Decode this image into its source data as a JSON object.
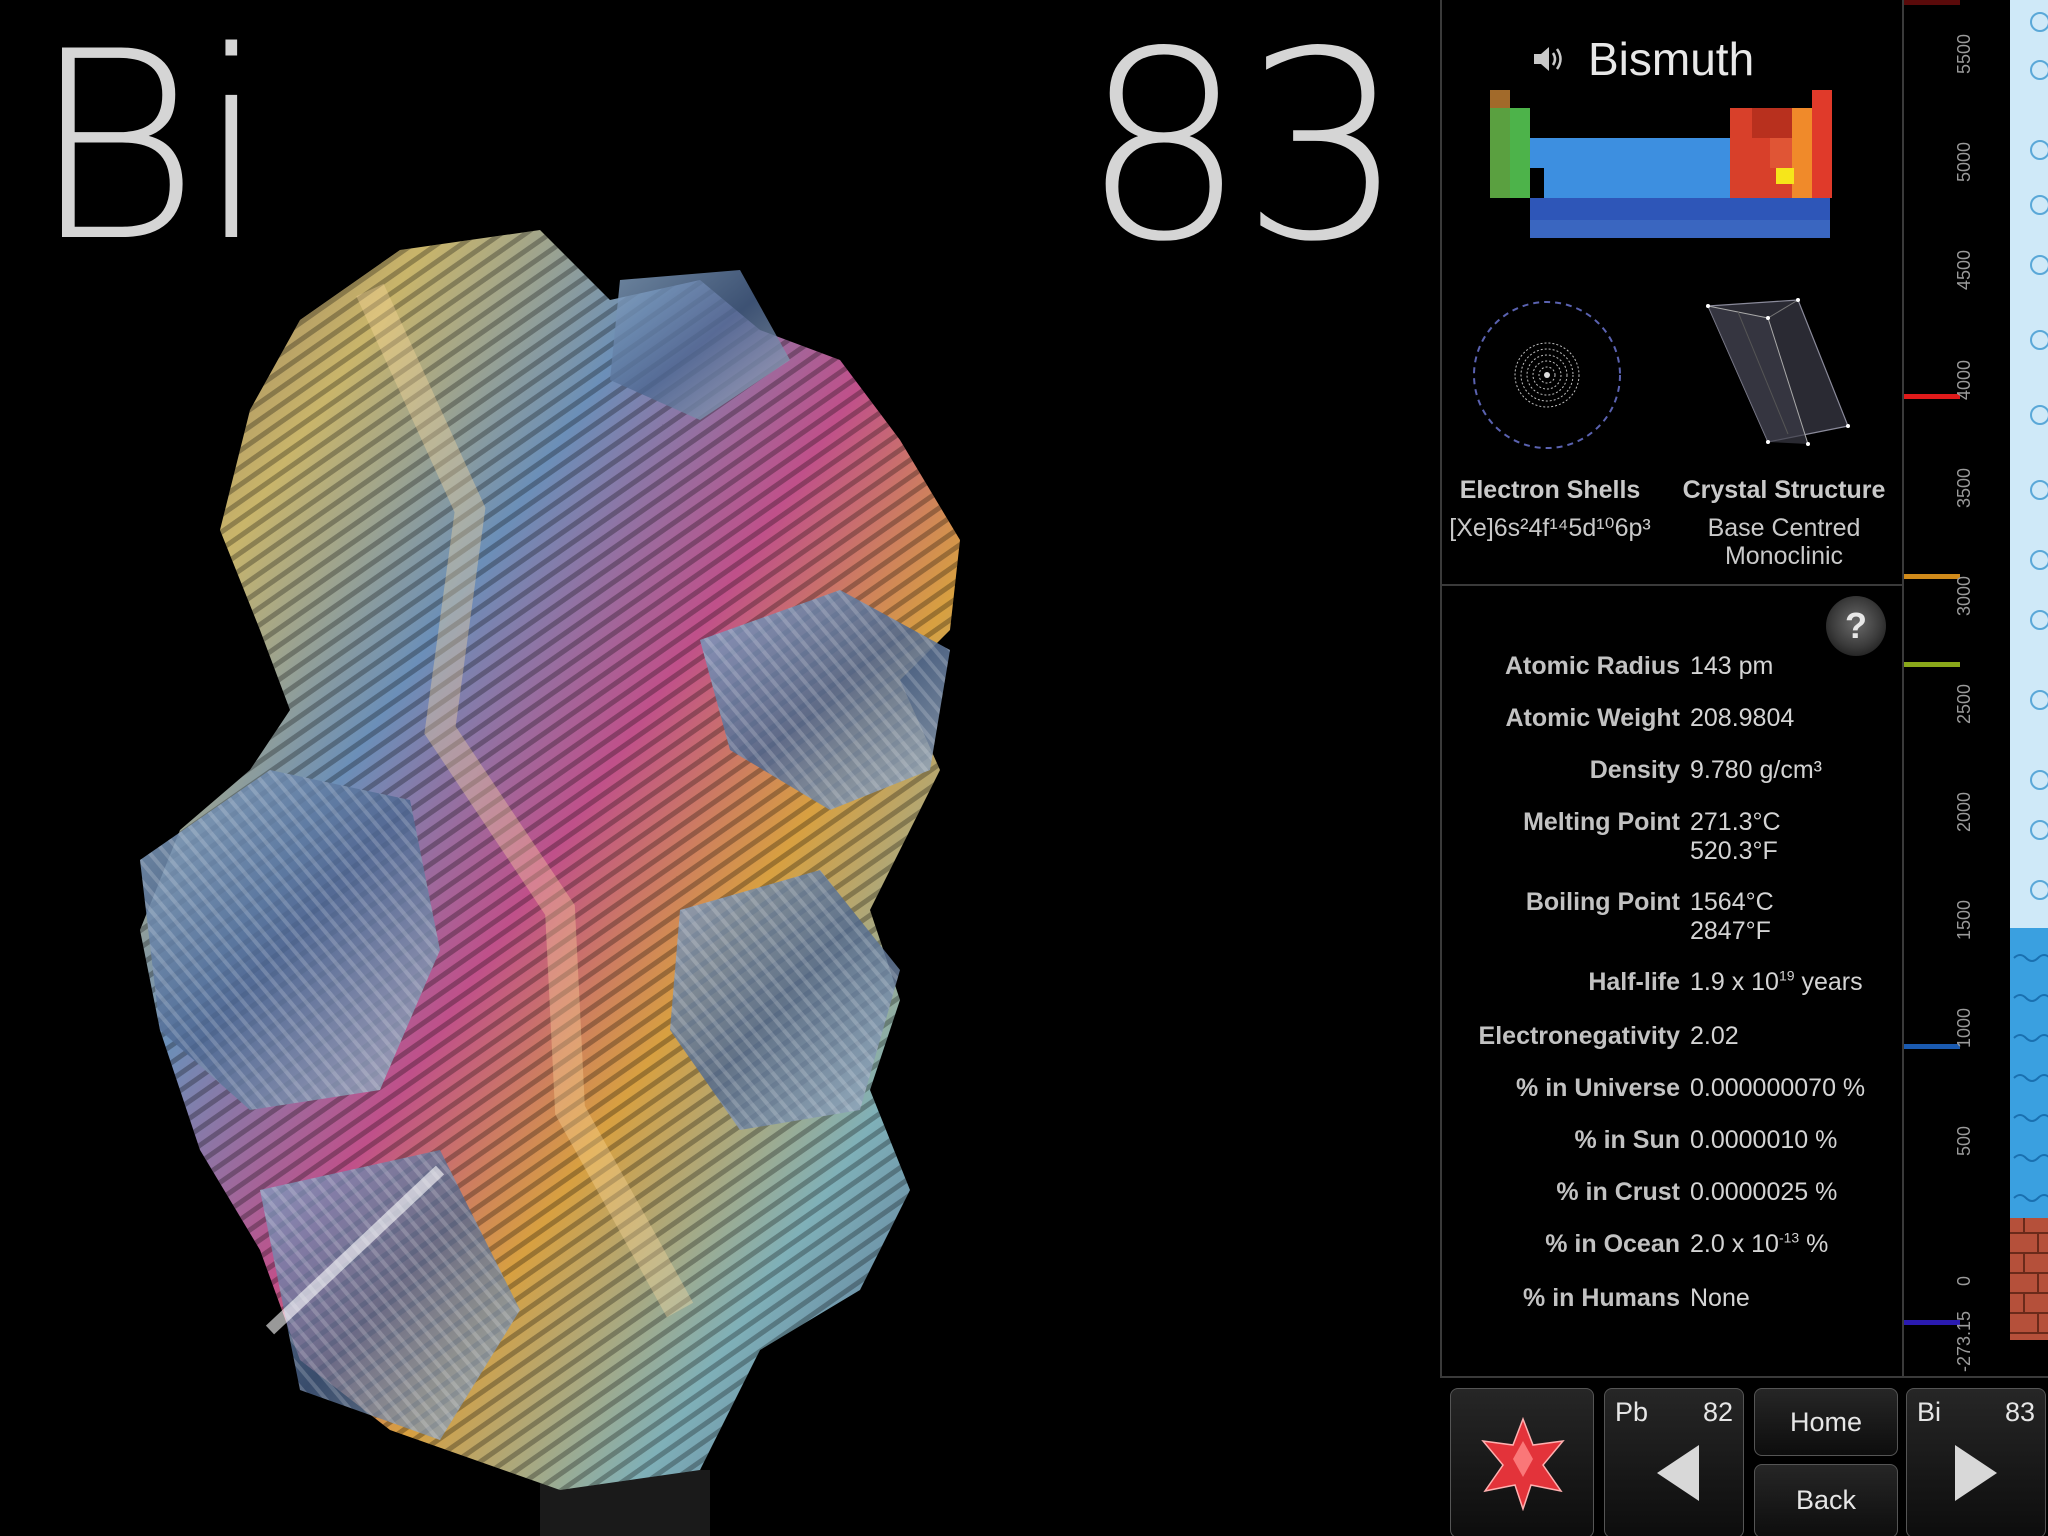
{
  "element": {
    "symbol": "Bi",
    "number": "83",
    "name": "Bismuth"
  },
  "diagrams": {
    "shells_label": "Electron Shells",
    "shells_config": "[Xe]6s²4f¹⁴5d¹⁰6p³",
    "crystal_label": "Crystal Structure",
    "crystal_value_line1": "Base Centred",
    "crystal_value_line2": "Monoclinic"
  },
  "help": {
    "label": "?"
  },
  "properties": [
    {
      "key": "Atomic Radius",
      "value": "143 pm"
    },
    {
      "key": "Atomic Weight",
      "value": "208.9804"
    },
    {
      "key": "Density",
      "value": "9.780 g/cm³"
    },
    {
      "key": "Melting Point",
      "value": "271.3°C",
      "value2": "520.3°F"
    },
    {
      "key": "Boiling Point",
      "value": "1564°C",
      "value2": "2847°F"
    },
    {
      "key": "Half-life",
      "value": "1.9 x 10",
      "sup": "19",
      "suffix": " years"
    },
    {
      "key": "Electronegativity",
      "value": "2.02"
    },
    {
      "key": "% in Universe",
      "value": "0.000000070 %"
    },
    {
      "key": "% in Sun",
      "value": "0.0000010 %"
    },
    {
      "key": "% in Crust",
      "value": "0.0000025 %"
    },
    {
      "key": "% in Ocean",
      "value": "2.0 x 10",
      "sup": "-13",
      "suffix": " %"
    },
    {
      "key": "% in Humans",
      "value": "None"
    }
  ],
  "temperature_scale": {
    "ticks": [
      "5500",
      "5000",
      "4500",
      "4000",
      "3500",
      "3000",
      "2500",
      "2000",
      "1500",
      "1000",
      "500",
      "0",
      "-273.15"
    ],
    "colors": {
      "solid": "#b5503a",
      "liquid": "#3aa0e0",
      "gas": "#cfe9f8"
    }
  },
  "nav": {
    "prev_symbol": "Pb",
    "prev_number": "82",
    "home_label": "Home",
    "back_label": "Back",
    "next_symbol": "Bi",
    "next_number": "83"
  }
}
